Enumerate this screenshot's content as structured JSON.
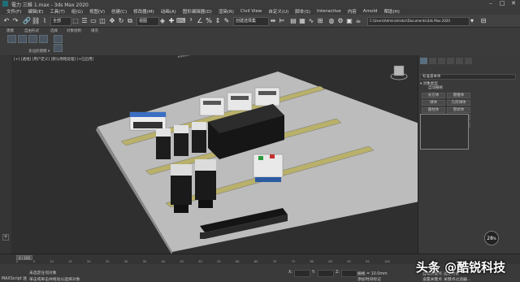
{
  "window": {
    "title": "電力 三維 1.max - 3ds Max 2020",
    "minimize": "–",
    "maximize": "□",
    "close": "✕"
  },
  "menu": [
    "文件(F)",
    "编辑(E)",
    "工具(T)",
    "组(G)",
    "视图(V)",
    "创建(C)",
    "修改器(M)",
    "动画(A)",
    "图形编辑器(D)",
    "渲染(R)",
    "Civil View",
    "自定义(U)",
    "脚本(S)",
    "Interactive",
    "内容",
    "Arnold",
    "帮助(H)"
  ],
  "toolbar": {
    "selection_filter": "全部",
    "ref_coord": "视图",
    "named_set": "创建选择集",
    "path": "C:\\Users\\Administrator\\Documents\\3ds Max 2020"
  },
  "ribbon": {
    "groups": [
      "建模",
      "自由形式",
      "选择",
      "对象绘制",
      "填充"
    ],
    "sub_label": "多边形建模 ▾"
  },
  "viewport": {
    "label": "[+] [透视] [用户定义] [默认明暗处理] [+已启用]"
  },
  "command_panel": {
    "category": "标准基本体",
    "object_type_header": "▾ 对象类型",
    "autogrid": "自动栅格",
    "buttons": [
      "长方体",
      "圆锥体",
      "球体",
      "几何球体",
      "圆柱体",
      "管状体",
      "圆环",
      "四棱锥",
      "茶壶",
      "平面",
      "加强型文本"
    ],
    "name_color_header": "▾ 名称和颜色"
  },
  "timeline": {
    "frame": "0 / 100",
    "ticks": [
      "0",
      "5",
      "10",
      "15",
      "20",
      "25",
      "30",
      "35",
      "40",
      "45",
      "50",
      "55",
      "60",
      "65",
      "70",
      "75",
      "80",
      "85",
      "90",
      "95",
      "100"
    ]
  },
  "status": {
    "line1": "未选定任何对象",
    "line2": "单击或单击并拖动以选择对象",
    "maxscript": "MAXScript 迷",
    "x_label": "X:",
    "y_label": "Y:",
    "z_label": "Z:",
    "grid": "栅格 = 10.0mm",
    "add_time_tag": "添加时间标记",
    "auto_key": "自动关键点",
    "set_key": "设置关键点",
    "selected": "选定对象",
    "key_filters": "关键点过滤器..."
  },
  "perf_badge": {
    "value": "28",
    "unit": "%"
  },
  "watermark": "头条 @酷锐科技"
}
